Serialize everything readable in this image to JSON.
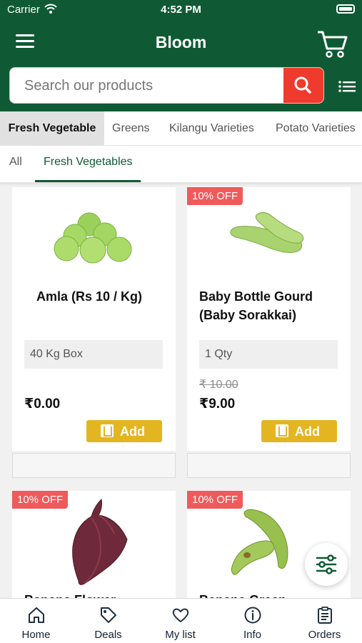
{
  "status_bar": {
    "carrier": "Carrier",
    "time": "4:52 PM"
  },
  "header": {
    "title": "Bloom",
    "menu_icon": "hamburger-icon",
    "cart_icon": "cart-icon"
  },
  "search": {
    "placeholder": "Search our products",
    "button_icon": "search-icon",
    "list_icon": "list-icon"
  },
  "category_tabs": [
    "Fresh Vegetable",
    "Greens",
    "Kilangu Varieties",
    "Potato Varieties"
  ],
  "sub_tabs": [
    "All",
    "Fresh Vegetables"
  ],
  "products": [
    {
      "name": "Amla (Rs 10 / Kg)",
      "badge": "",
      "variant": "40 Kg Box",
      "old_price": "",
      "price": "₹0.00",
      "add_label": "Add"
    },
    {
      "name": "Baby Bottle Gourd (Baby Sorakkai)",
      "badge": "10% OFF",
      "variant": "1 Qty",
      "old_price": "₹ 10.00",
      "price": "₹9.00",
      "add_label": "Add"
    },
    {
      "name": "Banana Flower",
      "badge": "10% OFF"
    },
    {
      "name": "Banana Green",
      "badge": "10% OFF"
    }
  ],
  "fab": {
    "icon": "filter-sliders-icon"
  },
  "bottom_nav": [
    {
      "label": "Home",
      "icon": "home-icon"
    },
    {
      "label": "Deals",
      "icon": "tag-icon"
    },
    {
      "label": "My list",
      "icon": "heart-icon"
    },
    {
      "label": "Info",
      "icon": "info-icon"
    },
    {
      "label": "Orders",
      "icon": "clipboard-icon"
    }
  ],
  "colors": {
    "brand": "#0f5a34",
    "search_button": "#ef3b2d",
    "badge": "#ef5a5a",
    "add_button": "#e3b521"
  }
}
